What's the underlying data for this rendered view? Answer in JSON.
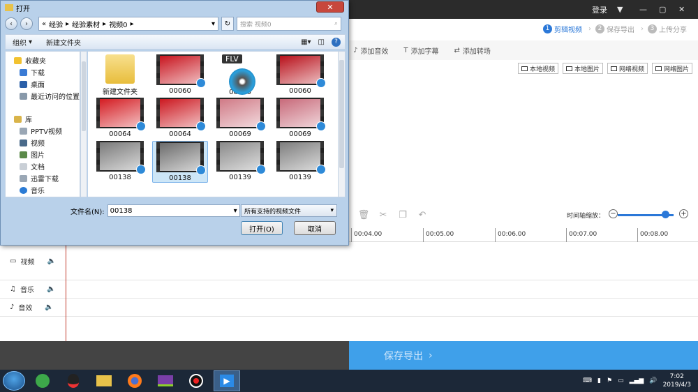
{
  "app": {
    "login_label": "登录",
    "steps": [
      {
        "num": "1",
        "label": "剪辑视频"
      },
      {
        "num": "2",
        "label": "保存导出"
      },
      {
        "num": "3",
        "label": "上传分享"
      }
    ],
    "toolbar": {
      "add_audio": "添加音效",
      "add_subtitle": "添加字幕",
      "add_transition": "添加转场"
    },
    "add_buttons": [
      "本地视频",
      "本地图片",
      "网络视频",
      "网络图片"
    ],
    "zoom_label": "时间轴缩放：",
    "zoom_level": 0.85,
    "ruler_ticks": [
      "00:04.00",
      "00:05.00",
      "00:06.00",
      "00:07.00",
      "00:08.00"
    ],
    "tracks": {
      "video": "视频",
      "music": "音乐",
      "effect": "音效"
    },
    "save_export": "保存导出"
  },
  "dialog": {
    "title": "打开",
    "breadcrumb": [
      "«",
      "经验",
      "经验素材",
      "视频0"
    ],
    "search_placeholder": "搜索 视频0",
    "organize": "组织",
    "new_folder": "新建文件夹",
    "sidebar": {
      "favorites": "收藏夹",
      "fav_items": [
        "下载",
        "桌面",
        "最近访问的位置"
      ],
      "library": "库",
      "lib_items": [
        "PPTV视频",
        "视频",
        "图片",
        "文档",
        "迅雷下载",
        "音乐"
      ]
    },
    "files": [
      {
        "name": "新建文件夹",
        "kind": "folder"
      },
      {
        "name": "00060",
        "kind": "video",
        "color": "#c8141e"
      },
      {
        "name": "00060",
        "kind": "flv",
        "tag": "FLV"
      },
      {
        "name": "00060",
        "kind": "video",
        "color": "#b8101a"
      },
      {
        "name": "00064",
        "kind": "video",
        "color": "#d41c22"
      },
      {
        "name": "00064",
        "kind": "video",
        "color": "#cc1820"
      },
      {
        "name": "00069",
        "kind": "video",
        "color": "#d07a86"
      },
      {
        "name": "00069",
        "kind": "video",
        "color": "#c86a7a"
      },
      {
        "name": "00138",
        "kind": "video",
        "color": "#7a7a7a"
      },
      {
        "name": "00138",
        "kind": "video",
        "color": "#6c6c6c",
        "selected": true
      },
      {
        "name": "00139",
        "kind": "video",
        "color": "#8a8a8a"
      },
      {
        "name": "00139",
        "kind": "video",
        "color": "#7e7e7e"
      }
    ],
    "filename_label": "文件名(N):",
    "filename_value": "00138",
    "filetype": "所有支持的视频文件",
    "open_button": "打开(O)",
    "cancel_button": "取消"
  },
  "taskbar": {
    "time": "7:02",
    "date": "2019/4/3"
  }
}
